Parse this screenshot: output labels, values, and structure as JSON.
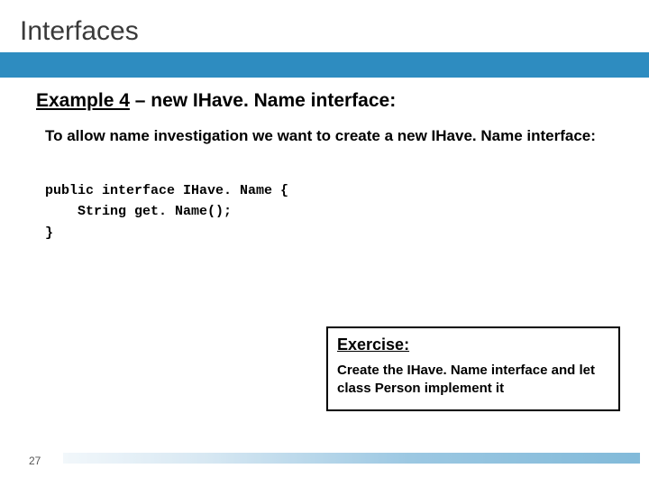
{
  "title": "Interfaces",
  "heading_underlined": "Example 4",
  "heading_rest": " – new IHave. Name interface:",
  "body1": "To allow name investigation we want to create a new IHave. Name interface:",
  "code_line1": "public interface IHave. Name {",
  "code_line2": "    String get. Name();",
  "code_line3": "}",
  "exercise_title": "Exercise:",
  "exercise_body": "Create the IHave. Name interface and let class Person implement it",
  "page_number": "27"
}
